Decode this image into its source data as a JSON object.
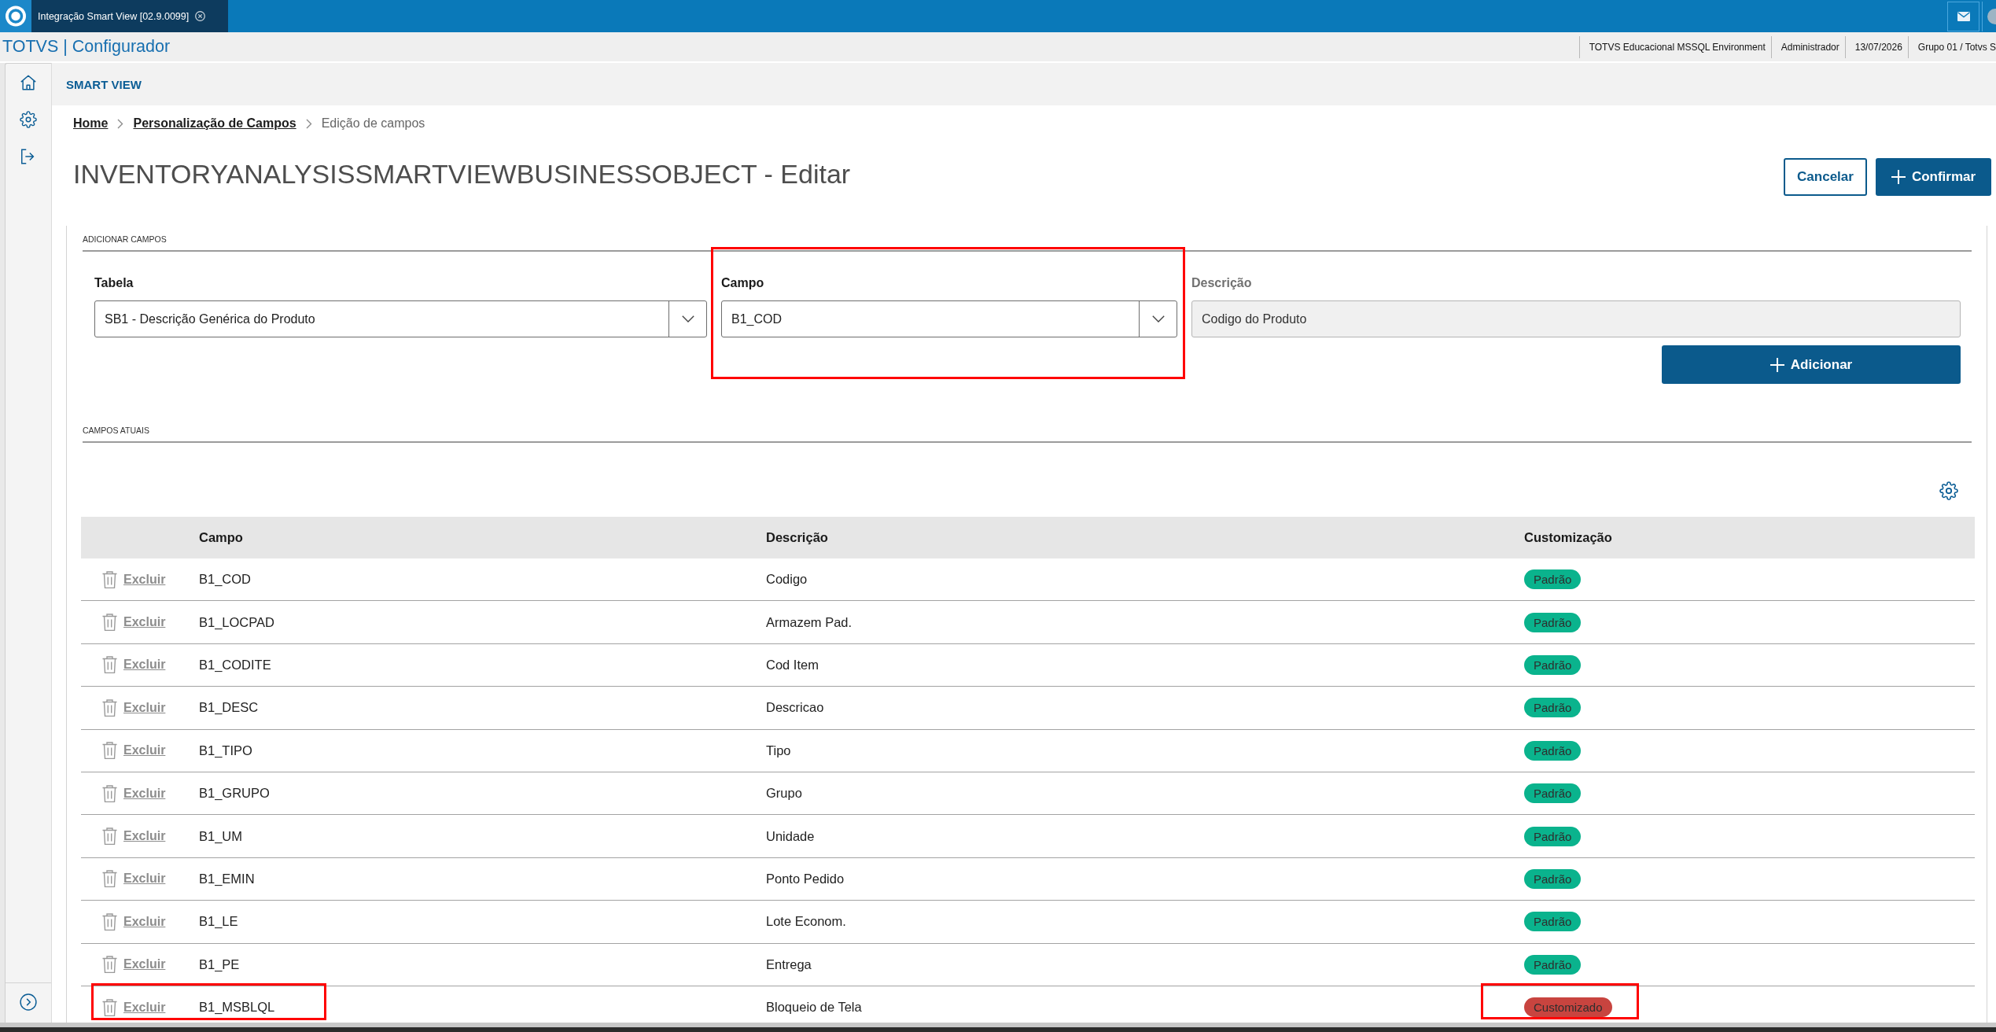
{
  "browser_tabs": [
    {
      "label": "Integração Smart View [02.9.0099]",
      "selected": true
    }
  ],
  "app_header": {
    "title": "TOTVS | Configurador",
    "info": [
      "TOTVS Educacional MSSQL Environment",
      "Administrador",
      "13/07/2026",
      "Grupo 01 / Totvs S"
    ]
  },
  "section_header": "SMART VIEW",
  "breadcrumb": [
    {
      "label": "Home",
      "kind": "link"
    },
    {
      "label": "Personalização de Campos",
      "kind": "link"
    },
    {
      "label": "Edição de campos",
      "kind": "current"
    }
  ],
  "page_title": "INVENTORYANALYSISSMARTVIEWBUSINESSOBJECT - Editar",
  "actions": [
    {
      "label": "Cancelar",
      "kind": "secondary"
    },
    {
      "label": "Confirmar",
      "kind": "primary"
    }
  ],
  "add_fields": {
    "heading": "ADICIONAR CAMPOS",
    "fields": [
      {
        "label": "Tabela",
        "value": "SB1 - Descrição Genérica do Produto",
        "kind": "select",
        "disabled": false,
        "highlighted": false
      },
      {
        "label": "Campo",
        "value": "B1_COD",
        "kind": "select",
        "disabled": false,
        "highlighted": true
      },
      {
        "label": "Descrição",
        "value": "Codigo do Produto",
        "kind": "text",
        "disabled": true,
        "highlighted": false
      }
    ],
    "add_button": {
      "label": "Adicionar",
      "kind": "primary"
    }
  },
  "current_fields": {
    "heading": "CAMPOS ATUAIS",
    "table": {
      "columns": [
        "Campo",
        "Descrição",
        "Customização"
      ],
      "rows": [
        {
          "action": "Excluir",
          "field": "B1_COD",
          "description": "Codigo",
          "customization": "Padrão",
          "color": "#0ab38d",
          "field_highlighted": false,
          "badge_highlighted": false
        },
        {
          "action": "Excluir",
          "field": "B1_LOCPAD",
          "description": "Armazem Pad.",
          "customization": "Padrão",
          "color": "#0ab38d",
          "field_highlighted": false,
          "badge_highlighted": false
        },
        {
          "action": "Excluir",
          "field": "B1_CODITE",
          "description": "Cod Item",
          "customization": "Padrão",
          "color": "#0ab38d",
          "field_highlighted": false,
          "badge_highlighted": false
        },
        {
          "action": "Excluir",
          "field": "B1_DESC",
          "description": "Descricao",
          "customization": "Padrão",
          "color": "#0ab38d",
          "field_highlighted": false,
          "badge_highlighted": false
        },
        {
          "action": "Excluir",
          "field": "B1_TIPO",
          "description": "Tipo",
          "customization": "Padrão",
          "color": "#0ab38d",
          "field_highlighted": false,
          "badge_highlighted": false
        },
        {
          "action": "Excluir",
          "field": "B1_GRUPO",
          "description": "Grupo",
          "customization": "Padrão",
          "color": "#0ab38d",
          "field_highlighted": false,
          "badge_highlighted": false
        },
        {
          "action": "Excluir",
          "field": "B1_UM",
          "description": "Unidade",
          "customization": "Padrão",
          "color": "#0ab38d",
          "field_highlighted": false,
          "badge_highlighted": false
        },
        {
          "action": "Excluir",
          "field": "B1_EMIN",
          "description": "Ponto Pedido",
          "customization": "Padrão",
          "color": "#0ab38d",
          "field_highlighted": false,
          "badge_highlighted": false
        },
        {
          "action": "Excluir",
          "field": "B1_LE",
          "description": "Lote Econom.",
          "customization": "Padrão",
          "color": "#0ab38d",
          "field_highlighted": false,
          "badge_highlighted": false
        },
        {
          "action": "Excluir",
          "field": "B1_PE",
          "description": "Entrega",
          "customization": "Padrão",
          "color": "#0ab38d",
          "field_highlighted": false,
          "badge_highlighted": false
        },
        {
          "action": "Excluir",
          "field": "B1_MSBLQL",
          "description": "Bloqueio de Tela",
          "customization": "Customizado",
          "color": "#c8443f",
          "field_highlighted": true,
          "badge_highlighted": true
        }
      ]
    }
  }
}
